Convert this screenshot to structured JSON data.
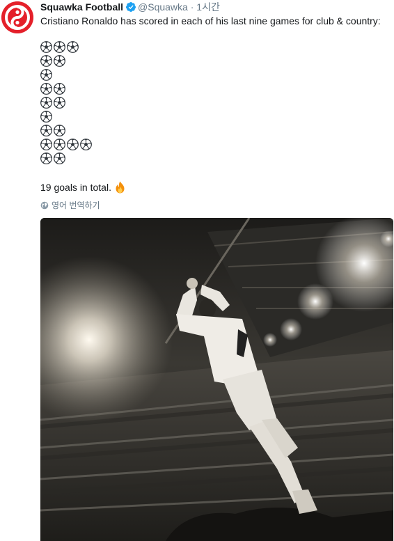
{
  "account": {
    "display_name": "Squawka Football",
    "handle": "@Squawka",
    "separator": "·",
    "timestamp": "1시간",
    "avatar_icon": "squawka-logo-icon",
    "brand_color": "#e4202a",
    "verified_icon": "verified-badge-icon",
    "verified_color": "#1da1f2"
  },
  "tweet": {
    "text": "Cristiano Ronaldo has scored in each of his last nine games for club & country:",
    "goal_rows": [
      3,
      2,
      1,
      2,
      2,
      1,
      2,
      4,
      2
    ],
    "goal_icon": "soccer-ball-icon",
    "summary": "19 goals in total.",
    "summary_icon": "fire-icon"
  },
  "translate": {
    "icon": "globe-icon",
    "label": "영어 번역하기"
  },
  "media": {
    "type": "photo",
    "icon": "player-celebration-photo"
  }
}
